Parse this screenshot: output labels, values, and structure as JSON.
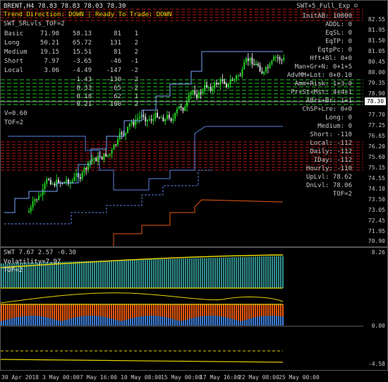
{
  "header": {
    "symbol_line": "BRENT,H4  78.83 78.83 78.03 78.30",
    "expert": "SWT+5_Full_Exp",
    "trend_line": "Trend Direction:  DOWN  |  Ready To Trade:  DOWN",
    "indicator_label": "SWT_SRLvls_TOF=2"
  },
  "levels_table": [
    {
      "name": "Basic",
      "a": "71.90",
      "b": "58.13",
      "c": "81",
      "d": "1"
    },
    {
      "name": "Long",
      "a": "50.21",
      "b": "65.72",
      "c": "131",
      "d": "2"
    },
    {
      "name": "Medium",
      "a": "19.15",
      "b": "15.51",
      "c": "81",
      "d": "2"
    },
    {
      "name": "Short",
      "a": "7.97",
      "b": "-3.65",
      "c": "-46",
      "d": "-1"
    },
    {
      "name": "Local",
      "a": "3.06",
      "b": "-4.49",
      "c": "-147",
      "d": "-2"
    },
    {
      "name": "",
      "a": "",
      "b": "-1.43",
      "c": "-130",
      "d": "-2"
    },
    {
      "name": "",
      "a": "",
      "b": "0.33",
      "c": "-65",
      "d": "-2"
    },
    {
      "name": "",
      "a": "",
      "b": "0.18",
      "c": "62",
      "d": "1"
    },
    {
      "name": "",
      "a": "",
      "b": "0.21",
      "c": "100",
      "d": "2"
    }
  ],
  "misc": {
    "v_label": "V=0.60",
    "tof_label": "TOF=2"
  },
  "stats": [
    {
      "label": "InitAB:",
      "value": "10000"
    },
    {
      "label": "ADDL:",
      "value": "0"
    },
    {
      "label": "EqSL:",
      "value": "0"
    },
    {
      "label": "EqTP:",
      "value": "0"
    },
    {
      "label": "EqtpPc:",
      "value": "0"
    },
    {
      "label": "Hft+Bl:",
      "value": "0+0"
    },
    {
      "label": "Man+Gr+N:",
      "value": "0+1+5"
    },
    {
      "label": "AdvMM+Lot:",
      "value": "0+0.10"
    },
    {
      "label": "Amm+Risk:",
      "value": "1+3.0"
    },
    {
      "label": "Pr+St+Mst:",
      "value": "4+4+1"
    },
    {
      "label": "ABrs+Br:",
      "value": "1+1"
    },
    {
      "label": "ChSP+Lre:",
      "value": "0+0"
    },
    {
      "label": "Long:",
      "value": "0"
    },
    {
      "label": "Medium:",
      "value": "0"
    },
    {
      "label": "Short:",
      "value": "-110"
    },
    {
      "label": "Local:",
      "value": "-112"
    },
    {
      "label": "Daily:",
      "value": "-112"
    },
    {
      "label": "IDay:",
      "value": "-112"
    },
    {
      "label": "Hourly:",
      "value": "-110"
    },
    {
      "label": "UpLvl:",
      "value": "78.62"
    },
    {
      "label": "DnLvl:",
      "value": "78.06"
    },
    {
      "label": "TOF=2",
      "value": ""
    }
  ],
  "price_axis": [
    "82.55",
    "81.95",
    "81.50",
    "81.05",
    "80.45",
    "80.00",
    "79.35",
    "78.90",
    "78.30",
    "77.70",
    "77.25",
    "76.65",
    "76.20",
    "75.60",
    "75.15",
    "74.55",
    "74.10",
    "73.50",
    "73.05",
    "72.45",
    "71.95",
    "71.35",
    "70.90"
  ],
  "current_price": "78.30",
  "sub_window": {
    "header": "SWT 7.67 2.57 -0.30",
    "volatility": "Volatility=7.97",
    "tof": "TOF=2",
    "axis": [
      "8.26",
      "0.00",
      "-4.58"
    ]
  },
  "dates": [
    "30 Apr 2018",
    "3 May 00:00",
    "7 May 16:00",
    "10 May 08:00",
    "15 May 00:00",
    "17 May 16:00",
    "22 May 08:00",
    "25 May 00:00"
  ],
  "colors": {
    "bull": "#21d421",
    "bear": "#d8d8d8",
    "orange": "#e85a10",
    "teal": "#3aa8a8",
    "red": "#e02020"
  }
}
